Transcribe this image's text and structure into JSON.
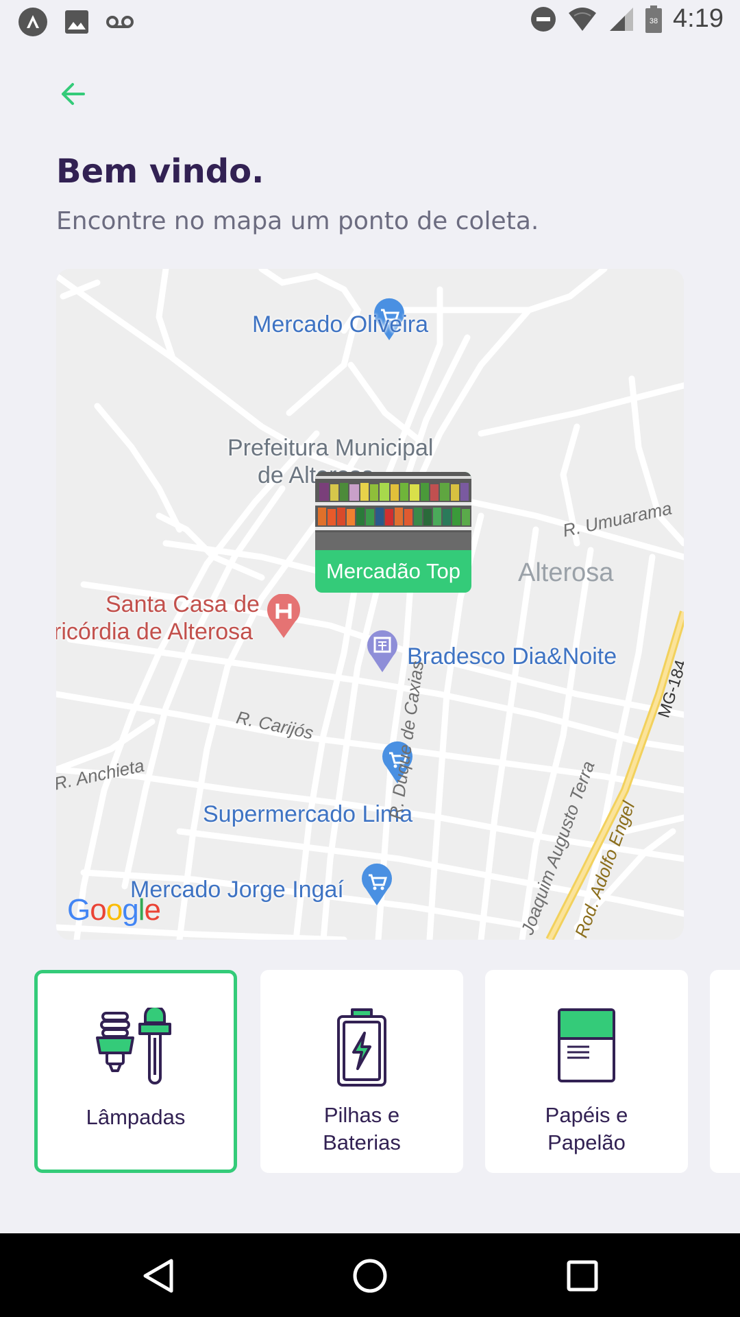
{
  "status_bar": {
    "time": "4:19",
    "left_icons": [
      "app-notification-icon",
      "image-notification-icon",
      "voicemail-icon"
    ],
    "right_icons": [
      "do-not-disturb-icon",
      "wifi-icon",
      "signal-icon",
      "battery-icon"
    ]
  },
  "header": {
    "title": "Bem vindo.",
    "subtitle": "Encontre no mapa um ponto de coleta."
  },
  "map": {
    "labels": {
      "mercado_oliveira": "Mercado Oliveira",
      "prefeitura_line1": "Prefeitura Municipal",
      "prefeitura_line2": "de Alterosa",
      "santa_casa_line1": "Santa Casa de",
      "santa_casa_line2": "ricórdia de Alterosa",
      "alterosa": "Alterosa",
      "bradesco": "Bradesco Dia&Noite",
      "supermercado_lima": "Supermercado Lima",
      "mercado_jorge": "Mercado Jorge Ingaí",
      "r_umuarama": "R. Umuarama",
      "r_carijos": "R. Carijós",
      "r_anchieta": "R. Anchieta",
      "r_duque": "R. Duque de Caxias",
      "r_joaquim": "R. Joaquim Augusto Terra",
      "rod_adolfo": "Rod. Adolfo Engel",
      "mg184": "MG-184"
    },
    "marker": {
      "name": "Mercadão Top",
      "image": "store-shelves-photo"
    },
    "attribution": "Google",
    "accent_color": "#34cb79"
  },
  "items": [
    {
      "title_line1": "Lâmpadas",
      "title_line2": "",
      "icon": "lamps-icon",
      "selected": true
    },
    {
      "title_line1": "Pilhas e",
      "title_line2": "Baterias",
      "icon": "battery-icon",
      "selected": false
    },
    {
      "title_line1": "Papéis e",
      "title_line2": "Papelão",
      "icon": "paper-icon",
      "selected": false
    }
  ],
  "nav": [
    "back-nav-icon",
    "home-nav-icon",
    "recents-nav-icon"
  ],
  "colors": {
    "primary": "#34cb79",
    "title": "#322153",
    "text": "#6c6c80",
    "background": "#f0f0f5"
  }
}
